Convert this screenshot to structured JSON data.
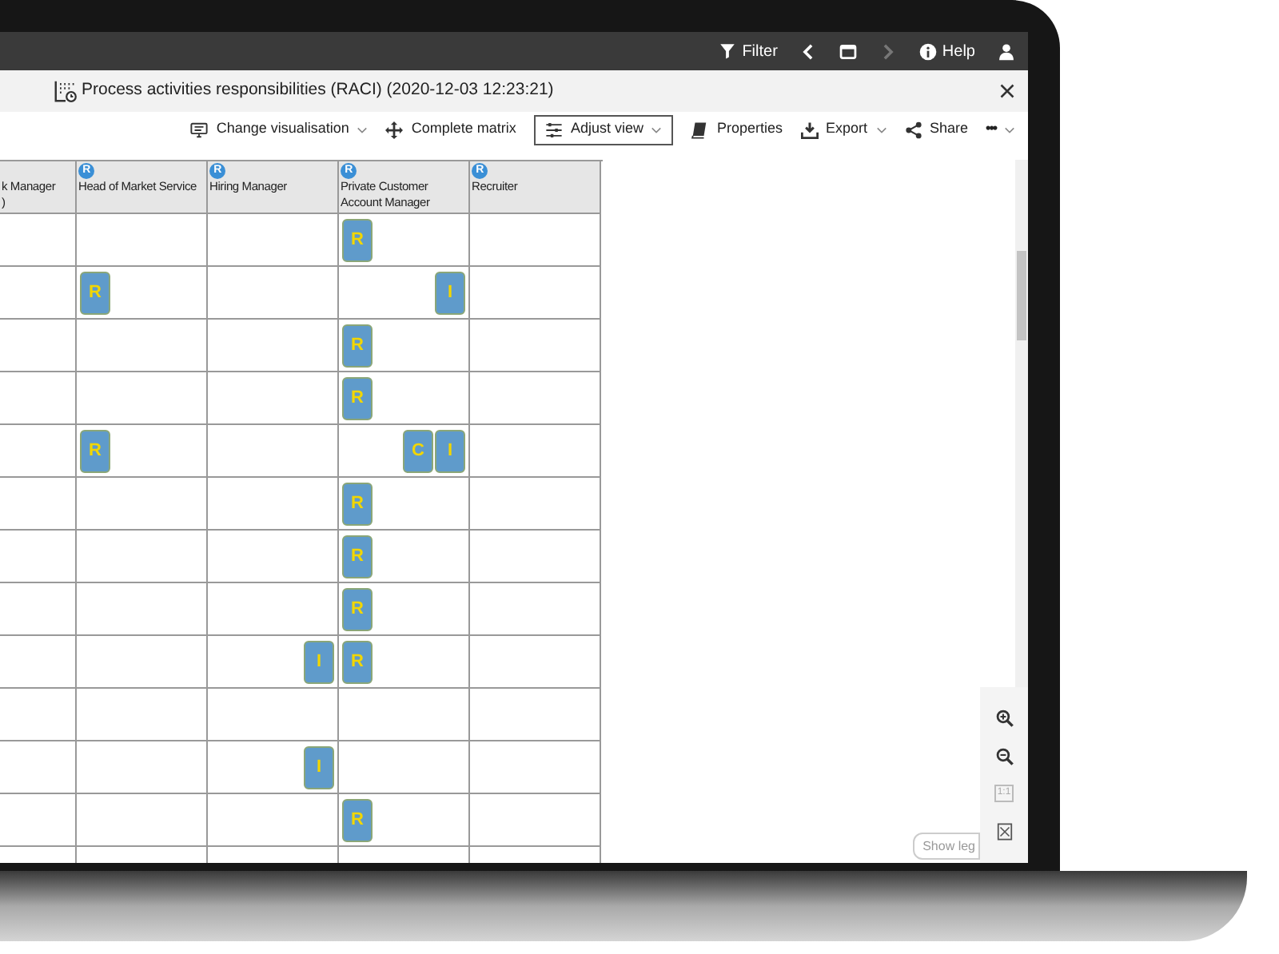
{
  "top_bar": {
    "filter": "Filter",
    "help": "Help",
    "forward_disabled": true
  },
  "title_bar": {
    "title": "Process activities responsibilities (RACI) (2020-12-03 12:23:21)"
  },
  "toolbar": [
    {
      "kind": "dropdown",
      "label": "Change visualisation",
      "boxed": false
    },
    {
      "kind": "button",
      "label": "Complete matrix",
      "boxed": false
    },
    {
      "kind": "dropdown",
      "label": "Adjust view",
      "boxed": true
    },
    {
      "kind": "button",
      "label": "Properties",
      "boxed": false
    },
    {
      "kind": "dropdown",
      "label": "Export",
      "boxed": false
    },
    {
      "kind": "button",
      "label": "Share",
      "boxed": false
    },
    {
      "kind": "more",
      "label": "•••",
      "boxed": false
    }
  ],
  "table": {
    "columns": [
      {
        "lines": [
          "k Manager",
          ")"
        ]
      },
      {
        "badge": "R",
        "lines": [
          "Head of Market Service"
        ]
      },
      {
        "badge": "R",
        "lines": [
          "Hiring Manager"
        ]
      },
      {
        "badge": "R",
        "lines": [
          "Private Customer",
          "Account Manager"
        ]
      },
      {
        "badge": "R",
        "lines": [
          "Recruiter"
        ]
      }
    ],
    "rows": [
      [
        {},
        {},
        {},
        {
          "left": [
            "R"
          ]
        },
        {}
      ],
      [
        {},
        {
          "left": [
            "R"
          ]
        },
        {},
        {
          "right": [
            "I"
          ]
        },
        {}
      ],
      [
        {},
        {},
        {},
        {
          "left": [
            "R"
          ]
        },
        {}
      ],
      [
        {},
        {},
        {},
        {
          "left": [
            "R"
          ]
        },
        {}
      ],
      [
        {},
        {
          "left": [
            "R"
          ]
        },
        {},
        {
          "right": [
            "C",
            "I"
          ]
        },
        {}
      ],
      [
        {},
        {},
        {},
        {
          "left": [
            "R"
          ]
        },
        {}
      ],
      [
        {},
        {},
        {},
        {
          "left": [
            "R"
          ]
        },
        {}
      ],
      [
        {},
        {},
        {},
        {
          "left": [
            "R"
          ]
        },
        {}
      ],
      [
        {},
        {},
        {
          "right": [
            "I"
          ]
        },
        {
          "left": [
            "R"
          ]
        },
        {}
      ],
      [
        {},
        {},
        {},
        {},
        {}
      ],
      [
        {},
        {},
        {
          "right": [
            "I"
          ]
        },
        {},
        {}
      ],
      [
        {},
        {},
        {},
        {
          "left": [
            "R"
          ]
        },
        {}
      ],
      [
        {},
        {},
        {},
        {},
        {}
      ]
    ]
  },
  "zoom_panel": {
    "actual_size": "1:1",
    "actual_size_disabled": true
  },
  "legend_button": "Show leg"
}
